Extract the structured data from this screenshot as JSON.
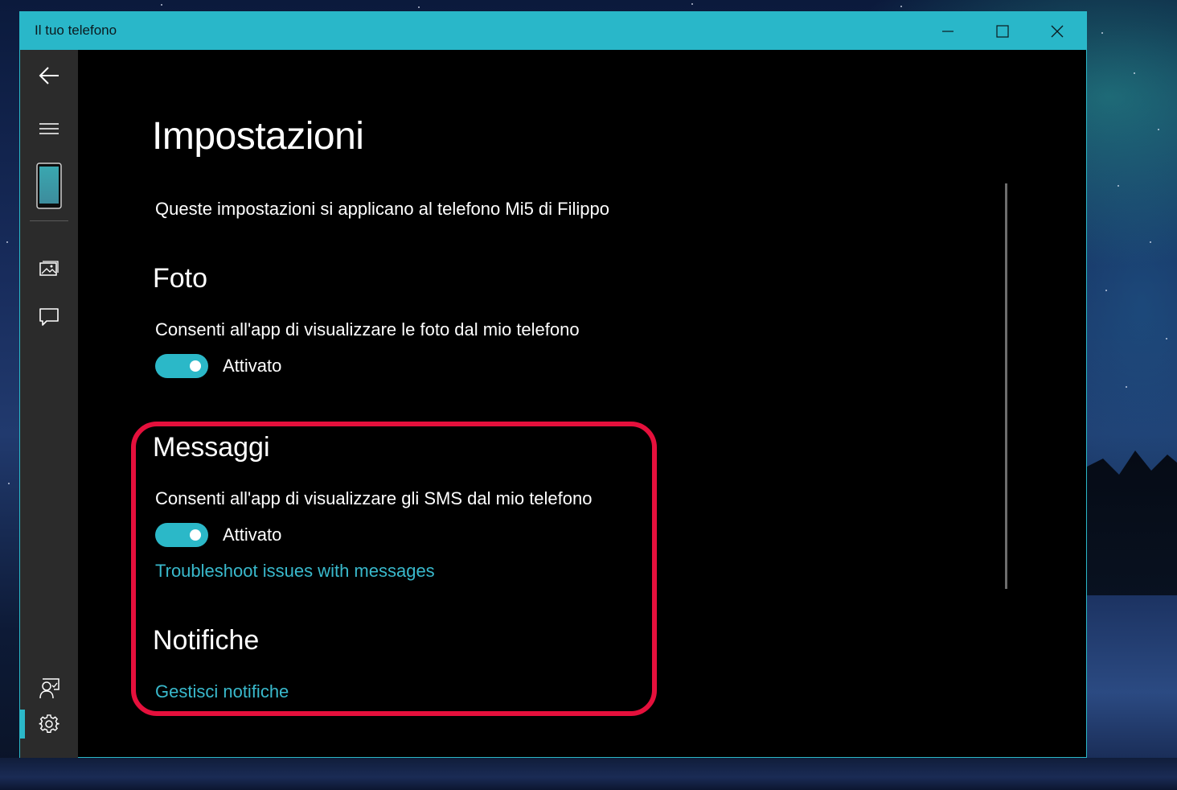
{
  "window": {
    "title": "Il tuo telefono"
  },
  "titlebar_buttons": {
    "minimize": "minimize-icon",
    "maximize": "maximize-icon",
    "close": "close-icon"
  },
  "sidebar": {
    "items": [
      {
        "name": "back",
        "icon": "arrow-left-icon"
      },
      {
        "name": "menu",
        "icon": "hamburger-icon"
      },
      {
        "name": "phone",
        "icon": "phone-icon"
      },
      {
        "name": "photos",
        "icon": "image-icon"
      },
      {
        "name": "messages",
        "icon": "chat-bubble-icon"
      },
      {
        "name": "feedback",
        "icon": "person-feedback-icon"
      },
      {
        "name": "settings",
        "icon": "gear-icon",
        "active": true
      }
    ]
  },
  "page": {
    "title": "Impostazioni",
    "subtitle": "Queste impostazioni si applicano al telefono Mi5 di Filippo"
  },
  "sections": {
    "foto": {
      "heading": "Foto",
      "description": "Consenti all'app di visualizzare le foto dal mio telefono",
      "toggle_label": "Attivato",
      "toggle_on": true
    },
    "messaggi": {
      "heading": "Messaggi",
      "description": "Consenti all'app di visualizzare gli SMS dal mio telefono",
      "toggle_label": "Attivato",
      "toggle_on": true,
      "link": "Troubleshoot issues with messages"
    },
    "notifiche": {
      "heading": "Notifiche",
      "link": "Gestisci notifiche"
    }
  },
  "colors": {
    "accent": "#2bb8c8",
    "titlebar": "#29b7c9",
    "highlight": "#e5103c",
    "sidebar": "#2b2b2b",
    "content_bg": "#000000",
    "link": "#39b9cc"
  }
}
